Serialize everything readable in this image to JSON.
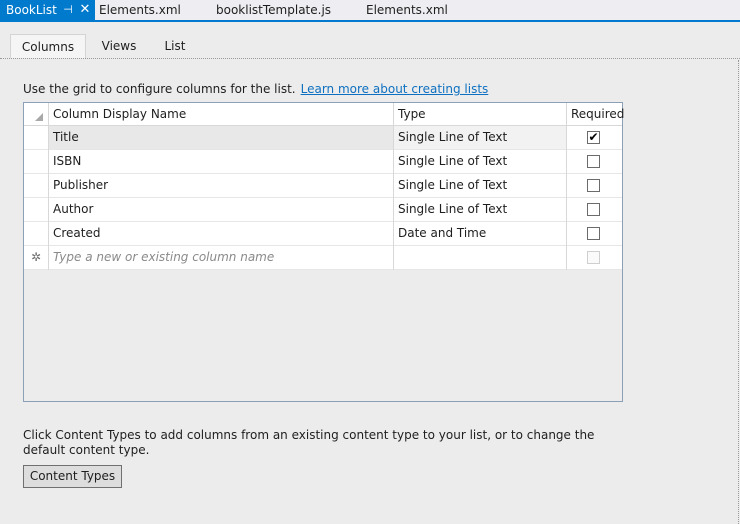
{
  "doc_tabs": [
    {
      "label": "BookList"
    },
    {
      "label": "Elements.xml"
    },
    {
      "label": "booklistTemplate.js"
    },
    {
      "label": "Elements.xml"
    }
  ],
  "doc_tab_icons": {
    "pin": "pin-icon",
    "close": "close-icon"
  },
  "view_tabs": [
    {
      "label": "Columns"
    },
    {
      "label": "Views"
    },
    {
      "label": "List"
    }
  ],
  "intro": {
    "text": "Use the grid to configure columns for the list.",
    "link": "Learn more about creating lists"
  },
  "grid": {
    "headers": {
      "name": "Column Display Name",
      "type": "Type",
      "required": "Required"
    },
    "rows": [
      {
        "name": "Title",
        "type": "Single Line of Text",
        "required": true
      },
      {
        "name": "ISBN",
        "type": "Single Line of Text",
        "required": false
      },
      {
        "name": "Publisher",
        "type": "Single Line of Text",
        "required": false
      },
      {
        "name": "Author",
        "type": "Single Line of Text",
        "required": false
      },
      {
        "name": "Created",
        "type": "Date and Time",
        "required": false
      }
    ],
    "new_row_placeholder": "Type a new or existing column name"
  },
  "content_types": {
    "text": "Click Content Types to add columns from an existing content type to your list, or to change the default content type.",
    "button_label": "Content Types"
  },
  "colors": {
    "accent": "#007acc",
    "link": "#0e70c0"
  }
}
